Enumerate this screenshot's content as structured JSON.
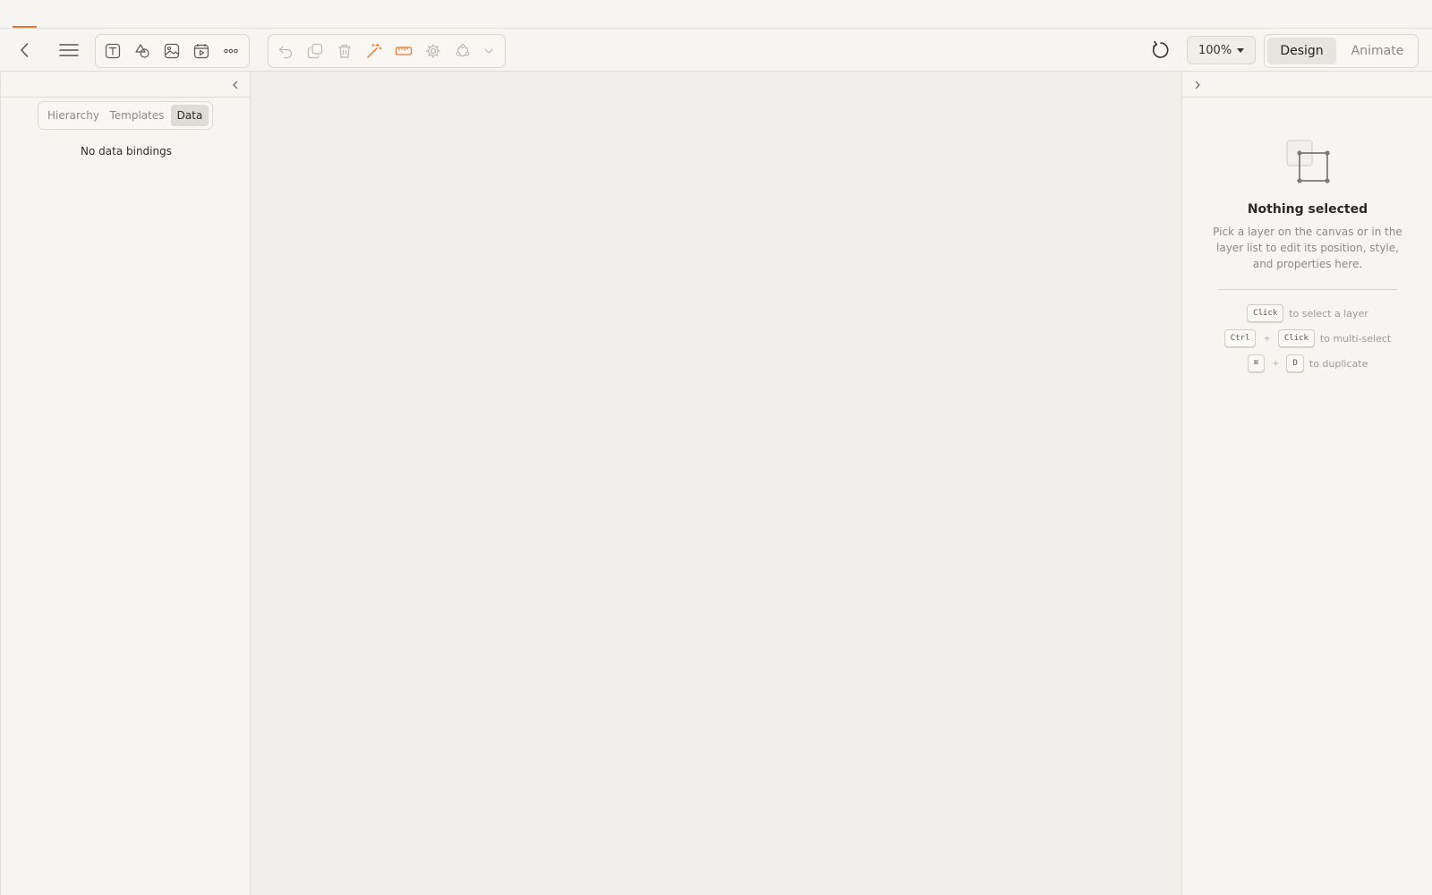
{
  "colors": {
    "accent": "#e8772e",
    "muted": "#8a8a86",
    "canvas": "#efeeea"
  },
  "progress": {
    "value_percent": 1.7
  },
  "toolbar": {
    "back_icon": "chevron-left-icon",
    "menu_icon": "hamburger-menu-icon",
    "insert_tools": [
      "text-icon",
      "shapes-icon",
      "image-icon",
      "video-icon",
      "more-icon"
    ],
    "edit_tools": [
      "undo-icon",
      "duplicate-icon",
      "trash-icon",
      "magic-wand-icon",
      "ruler-icon",
      "gear-icon",
      "component-icon",
      "chevron-down-icon"
    ],
    "reset_icon": "refresh-icon",
    "zoom_value": "100%",
    "modes": {
      "design": "Design",
      "animate": "Animate",
      "active": "design"
    }
  },
  "left_panel": {
    "tabs": [
      "Hierarchy",
      "Templates",
      "Data"
    ],
    "active_tab": "Data",
    "empty_message": "No data bindings"
  },
  "right_panel": {
    "title": "Nothing selected",
    "description": "Pick a layer on the canvas or in the layer list to edit its position, style, and properties here.",
    "shortcuts": [
      {
        "keys": [
          "Click"
        ],
        "text": "to select a layer"
      },
      {
        "keys": [
          "Ctrl",
          "Click"
        ],
        "text": "to multi-select"
      },
      {
        "keys": [
          "⌘",
          "D"
        ],
        "text": "to duplicate"
      }
    ],
    "plus_sign": "+"
  }
}
